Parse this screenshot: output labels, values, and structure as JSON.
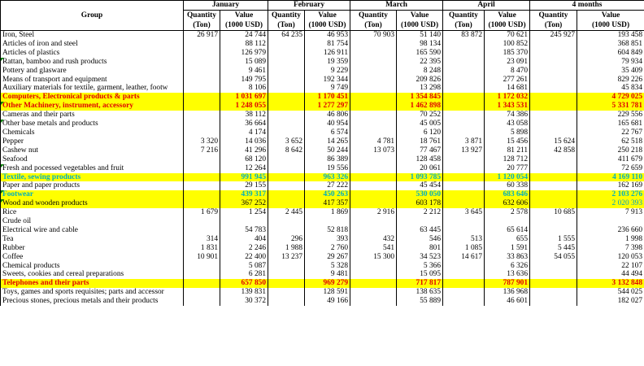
{
  "header": {
    "group": "Group",
    "periods": [
      "January",
      "February",
      "March",
      "April",
      "4 months"
    ],
    "qty_label": "Quantity",
    "qty_unit": "(Ton)",
    "val_label": "Value",
    "val_unit": "(1000 USD)"
  },
  "rows": [
    {
      "name": "Iron, Steel",
      "v": [
        "26 917",
        "24 744",
        "64 235",
        "46 953",
        "70 903",
        "51 140",
        "83 872",
        "70 621",
        "245 927",
        "193 458"
      ]
    },
    {
      "name": "Articles of iron and steel",
      "v": [
        "",
        "88 112",
        "",
        "81 754",
        "",
        "98 134",
        "",
        "100 852",
        "",
        "368 851"
      ]
    },
    {
      "name": "Articles of plastics",
      "v": [
        "",
        "126 979",
        "",
        "126 911",
        "",
        "165 590",
        "",
        "185 370",
        "",
        "604 849"
      ]
    },
    {
      "name": "Rattan, bamboo and rush products",
      "mark": true,
      "v": [
        "",
        "15 089",
        "",
        "19 359",
        "",
        "22 395",
        "",
        "23 091",
        "",
        "79 934"
      ]
    },
    {
      "name": "Pottery and glasware",
      "v": [
        "",
        "9 461",
        "",
        "9 229",
        "",
        "8 248",
        "",
        "8 470",
        "",
        "35 409"
      ]
    },
    {
      "name": "Means of transport and equipment",
      "v": [
        "",
        "149 795",
        "",
        "192 344",
        "",
        "209 826",
        "",
        "277 261",
        "",
        "829 226"
      ]
    },
    {
      "name": "Auxiliary materials for textile, garment, leather, footw",
      "v": [
        "",
        "8 106",
        "",
        "9 749",
        "",
        "13 298",
        "",
        "14 681",
        "",
        "45 834"
      ]
    },
    {
      "name": "Computers, Electronical products & parts",
      "hl": "red",
      "v": [
        "",
        "1 031 697",
        "",
        "1 170 451",
        "",
        "1 354 845",
        "",
        "1 172 032",
        "",
        "4 729 025"
      ]
    },
    {
      "name": "Other Machinery, instrument, accessory",
      "hl": "red",
      "mark": true,
      "v": [
        "",
        "1 248 055",
        "",
        "1 277 297",
        "",
        "1 462 898",
        "",
        "1 343 531",
        "",
        "5 331 781"
      ]
    },
    {
      "name": "Cameras and their parts",
      "v": [
        "",
        "38 112",
        "",
        "46 806",
        "",
        "70 252",
        "",
        "74 386",
        "",
        "229 556"
      ]
    },
    {
      "name": "Other base metals and products",
      "mark": true,
      "v": [
        "",
        "36 664",
        "",
        "40 954",
        "",
        "45 005",
        "",
        "43 058",
        "",
        "165 681"
      ]
    },
    {
      "name": "Chemicals",
      "v": [
        "",
        "4 174",
        "",
        "6 574",
        "",
        "6 120",
        "",
        "5 898",
        "",
        "22 767"
      ]
    },
    {
      "name": "Pepper",
      "v": [
        "3 320",
        "14 036",
        "3 652",
        "14 265",
        "4 781",
        "18 761",
        "3 871",
        "15 456",
        "15 624",
        "62 518"
      ]
    },
    {
      "name": "Cashew nut",
      "v": [
        "7 216",
        "41 296",
        "8 642",
        "50 244",
        "13 073",
        "77 467",
        "13 927",
        "81 211",
        "42 858",
        "250 218"
      ]
    },
    {
      "name": "Seafood",
      "v": [
        "",
        "68 120",
        "",
        "86 389",
        "",
        "128 458",
        "",
        "128 712",
        "",
        "411 679"
      ]
    },
    {
      "name": "Fresh and pocessed vegetables and fruit",
      "mark": true,
      "v": [
        "",
        "12 264",
        "",
        "19 556",
        "",
        "20 061",
        "",
        "20 777",
        "",
        "72 659"
      ]
    },
    {
      "name": "Textile, sewing products",
      "hl": "cyan",
      "v": [
        "",
        "991 945",
        "",
        "963 326",
        "",
        "1 093 785",
        "",
        "1 120 054",
        "",
        "4 169 110"
      ]
    },
    {
      "name": "Paper and paper products",
      "v": [
        "",
        "29 155",
        "",
        "27 222",
        "",
        "45 454",
        "",
        "60 338",
        "",
        "162 169"
      ]
    },
    {
      "name": "Footwear",
      "hl": "cyan",
      "mark": true,
      "v": [
        "",
        "439 317",
        "",
        "450 263",
        "",
        "530 050",
        "",
        "683 646",
        "",
        "2 103 276"
      ]
    },
    {
      "name": "Wood and wooden products",
      "hl": "dark",
      "mark": true,
      "v": [
        "",
        "367 252",
        "",
        "417 357",
        "",
        "603 178",
        "",
        "632 606",
        "",
        "2 020 393"
      ]
    },
    {
      "name": "Rice",
      "v": [
        "1 679",
        "1 254",
        "2 445",
        "1 869",
        "2 916",
        "2 212",
        "3 645",
        "2 578",
        "10 685",
        "7 913"
      ]
    },
    {
      "name": "Crude oil",
      "v": [
        "",
        "",
        "",
        "",
        "",
        "",
        "",
        "",
        "",
        ""
      ]
    },
    {
      "name": "Electrical wire and cable",
      "v": [
        "",
        "54 783",
        "",
        "52 818",
        "",
        "63 445",
        "",
        "65 614",
        "",
        "236 660"
      ]
    },
    {
      "name": "Tea",
      "v": [
        "314",
        "404",
        "296",
        "393",
        "432",
        "546",
        "513",
        "655",
        "1 555",
        "1 998"
      ]
    },
    {
      "name": "Rubber",
      "v": [
        "1 831",
        "2 246",
        "1 988",
        "2 760",
        "541",
        "801",
        "1 085",
        "1 591",
        "5 445",
        "7 398"
      ]
    },
    {
      "name": "Coffee",
      "v": [
        "10 901",
        "22 400",
        "13 237",
        "29 267",
        "15 300",
        "34 523",
        "14 617",
        "33 863",
        "54 055",
        "120 053"
      ]
    },
    {
      "name": "Chemical products",
      "v": [
        "",
        "5 087",
        "",
        "5 328",
        "",
        "5 366",
        "",
        "6 326",
        "",
        "22 107"
      ]
    },
    {
      "name": "Sweets, cookies and cereal preparations",
      "v": [
        "",
        "6 281",
        "",
        "9 481",
        "",
        "15 095",
        "",
        "13 636",
        "",
        "44 494"
      ]
    },
    {
      "name": "Telephones and their parts",
      "hl": "red",
      "v": [
        "",
        "657 850",
        "",
        "969 279",
        "",
        "717 817",
        "",
        "787 901",
        "",
        "3 132 848"
      ]
    },
    {
      "name": "Toys, games and sports requisites; parts and accessor",
      "v": [
        "",
        "139 831",
        "",
        "128 591",
        "",
        "138 635",
        "",
        "136 968",
        "",
        "544 025"
      ]
    },
    {
      "name": "Precious stones, precious metals and their products",
      "v": [
        "",
        "30 372",
        "",
        "49 166",
        "",
        "55 889",
        "",
        "46 601",
        "",
        "182 027"
      ]
    }
  ]
}
